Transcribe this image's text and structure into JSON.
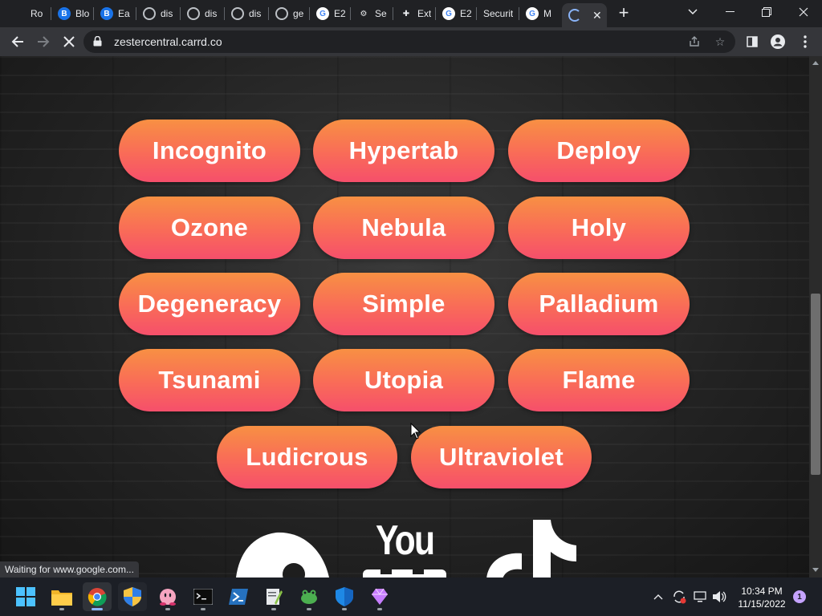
{
  "browser": {
    "tabs": [
      {
        "title": "Ro",
        "icon": "generic-page-icon"
      },
      {
        "title": "Blo",
        "icon": "blogger-icon"
      },
      {
        "title": "Ea",
        "icon": "blogger-icon"
      },
      {
        "title": "dis",
        "icon": "globe-icon"
      },
      {
        "title": "dis",
        "icon": "globe-icon"
      },
      {
        "title": "dis",
        "icon": "globe-icon"
      },
      {
        "title": "ge",
        "icon": "globe-icon"
      },
      {
        "title": "E2",
        "icon": "google-icon"
      },
      {
        "title": "Se",
        "icon": "gear-icon"
      },
      {
        "title": "Ext",
        "icon": "puzzle-icon"
      },
      {
        "title": "E2",
        "icon": "google-icon"
      },
      {
        "title": "Securit",
        "icon": "none"
      },
      {
        "title": "M",
        "icon": "google-icon"
      },
      {
        "title": "",
        "icon": "loading-spinner-icon",
        "active": true
      }
    ],
    "new_tab_label": "+",
    "url": "zestercentral.carrd.co",
    "status_text": "Waiting for www.google.com..."
  },
  "page": {
    "buttons": [
      [
        "Incognito",
        "Hypertab",
        "Deploy"
      ],
      [
        "Ozone",
        "Nebula",
        "Holy"
      ],
      [
        "Degeneracy",
        "Simple",
        "Palladium"
      ],
      [
        "Tsunami",
        "Utopia",
        "Flame"
      ],
      [
        "Ludicrous",
        "Ultraviolet"
      ]
    ],
    "social_logo_text": "You",
    "button_gradient": {
      "top": "#f89043",
      "bottom": "#f64f6b"
    }
  },
  "taskbar": {
    "apps": [
      "start-icon",
      "file-explorer-icon",
      "chrome-icon",
      "security-shield-icon",
      "kirby-icon",
      "terminal-icon",
      "powershell-icon",
      "notepad-plus-plus-icon",
      "frog-app-icon",
      "defender-icon",
      "gem-app-icon"
    ],
    "time": "10:34 PM",
    "date": "11/15/2022",
    "notification_count": "1"
  }
}
